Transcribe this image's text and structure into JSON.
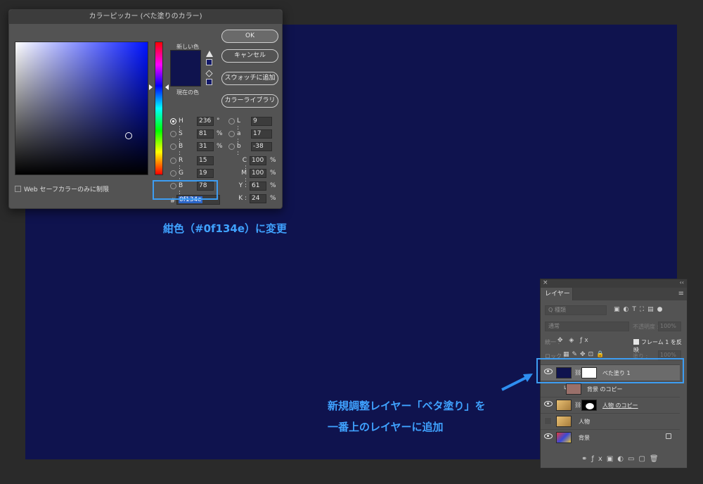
{
  "dialog": {
    "title": "カラーピッカー (べた塗りのカラー)",
    "new_label": "新しい色",
    "current_label": "現在の色",
    "buttons": {
      "ok": "OK",
      "cancel": "キャンセル",
      "add_swatch": "スウォッチに追加",
      "library": "カラーライブラリ"
    },
    "fields": {
      "H": {
        "label": "H :",
        "value": "236",
        "unit": "°"
      },
      "S": {
        "label": "S :",
        "value": "81",
        "unit": "%"
      },
      "B": {
        "label": "B :",
        "value": "31",
        "unit": "%"
      },
      "R": {
        "label": "R :",
        "value": "15"
      },
      "G": {
        "label": "G :",
        "value": "19"
      },
      "Bl": {
        "label": "B :",
        "value": "78"
      },
      "L": {
        "label": "L :",
        "value": "9"
      },
      "a": {
        "label": "a :",
        "value": "17"
      },
      "b": {
        "label": "b :",
        "value": "-38"
      },
      "C": {
        "label": "C :",
        "value": "100",
        "unit": "%"
      },
      "M": {
        "label": "M :",
        "value": "100",
        "unit": "%"
      },
      "Y": {
        "label": "Y :",
        "value": "61",
        "unit": "%"
      },
      "K": {
        "label": "K :",
        "value": "24",
        "unit": "%"
      }
    },
    "hex_prefix": "#",
    "hex_value": "0f134e",
    "web_only": "Web セーフカラーのみに制限"
  },
  "annotations": {
    "color_change": "紺色（#0f134e）に変更",
    "add_layer_line1": "新規調整レイヤー「ベタ塗り」を",
    "add_layer_line2": "一番上のレイヤーに追加"
  },
  "layers_panel": {
    "tab": "レイヤー",
    "kind_placeholder": "Q 種類",
    "blend_mode": "通常",
    "opacity_label": "不透明度 :",
    "opacity_value": "100%",
    "unify_label": "統一 :",
    "propagate_label": "フレーム 1 を反映",
    "lock_label": "ロック :",
    "fill_label": "塗り :",
    "fill_value": "100%",
    "layers": [
      {
        "name": "べた塗り 1"
      },
      {
        "name": "背景 のコピー"
      },
      {
        "name": "人物 のコピー"
      },
      {
        "name": "人物"
      },
      {
        "name": "背景"
      }
    ]
  },
  "colors": {
    "fill": "#0f134e",
    "accent": "#3d9df2"
  }
}
